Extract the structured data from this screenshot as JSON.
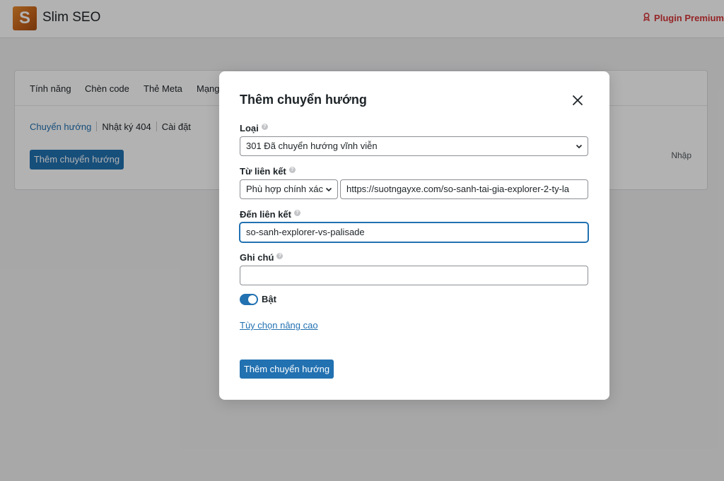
{
  "app": {
    "logo_letter": "S",
    "title": "Slim SEO",
    "premium_label": "Plugin Premium"
  },
  "main_tabs": [
    {
      "label": "Tính năng"
    },
    {
      "label": "Chèn code"
    },
    {
      "label": "Thẻ Meta"
    },
    {
      "label": "Mạng"
    }
  ],
  "sub_tabs": [
    {
      "label": "Chuyển hướng",
      "active": true
    },
    {
      "label": "Nhật ký 404",
      "active": false
    },
    {
      "label": "Cài đặt",
      "active": false
    }
  ],
  "page": {
    "add_button_label": "Thêm chuyển hướng",
    "import_label": "Nhập"
  },
  "modal": {
    "title": "Thêm chuyển hướng",
    "close_icon": "close-icon",
    "type_label": "Loại",
    "type_value": "301 Đã chuyển hướng vĩnh viễn",
    "from_label": "Từ liên kết",
    "match_value": "Phù hợp chính xác",
    "from_value": "https://suotngayxe.com/so-sanh-tai-gia-explorer-2-ty-la",
    "to_label": "Đến liên kết",
    "to_value": "so-sanh-explorer-vs-palisade",
    "note_label": "Ghi chú",
    "note_value": "",
    "enabled_label": "Bật",
    "enabled": true,
    "advanced_link": "Tùy chọn nâng cao",
    "submit_label": "Thêm chuyển hướng"
  },
  "colors": {
    "accent": "#2271b1",
    "premium": "#d63638",
    "logo": "#d9731f"
  }
}
